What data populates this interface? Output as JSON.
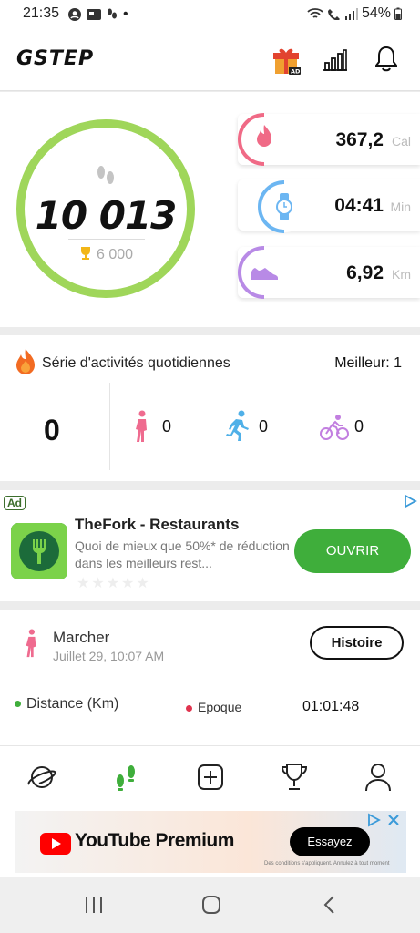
{
  "status_bar": {
    "time": "21:35",
    "dot": "•",
    "battery": "54%"
  },
  "app": {
    "logo": "GSTEP"
  },
  "header_icons": [
    "gift-ad-icon",
    "bar-chart-icon",
    "bell-icon"
  ],
  "gift_badge": "AD",
  "steps": {
    "count": "10 013",
    "goal": "6 000",
    "ring_progress": 1.0
  },
  "metrics": [
    {
      "value": "367,2",
      "unit": "Cal",
      "icon": "flame-icon",
      "color": "#f06a86"
    },
    {
      "value": "04:41",
      "unit": "Min",
      "icon": "watch-icon",
      "color": "#6cb6f2"
    },
    {
      "value": "6,92",
      "unit": "Km",
      "icon": "shoe-icon",
      "color": "#b88ae6"
    }
  ],
  "streak": {
    "title": "Série d'activités quotidiennes",
    "best": "Meilleur: 1",
    "count": "0",
    "walk": "0",
    "run": "0",
    "bike": "0"
  },
  "ad1": {
    "badge": "Ad",
    "app_name": "TheFork - Restaurants",
    "description": "Quoi de mieux que 50%* de réduction dans les meilleurs rest...",
    "cta": "OUVRIR",
    "stars": "★★★★★"
  },
  "activity": {
    "type": "Marcher",
    "date": "Juillet 29, 10:07 AM",
    "history_button": "Histoire",
    "distance_label": "Distance (Km)",
    "epoque_label": "Epoque",
    "time_value": "01:01:48"
  },
  "tabs": [
    "planet-icon",
    "footsteps-icon",
    "plus-icon",
    "trophy-icon",
    "profile-icon"
  ],
  "ad2": {
    "brand": "YouTube Premium",
    "cta": "Essayez",
    "fine_print": "Des conditions s'appliquent. Annulez à tout moment"
  },
  "colors": {
    "accent": "#3fae3b",
    "ring": "#9fd65a",
    "active_tab": "#3fae3b"
  }
}
